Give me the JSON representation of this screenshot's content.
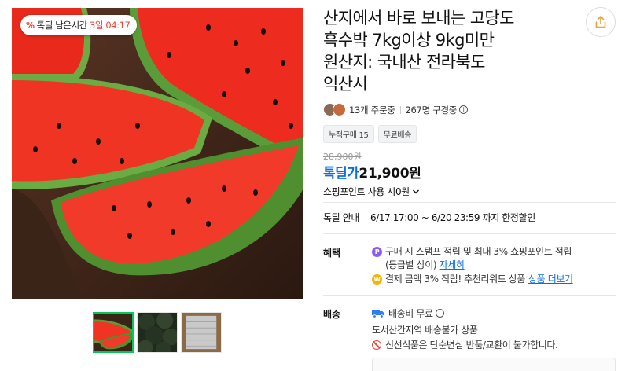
{
  "gallery": {
    "timer_badge": {
      "icon_text": "%",
      "label": "톡딜 남은시간",
      "remaining": "3일 04:17"
    },
    "thumbnails": [
      {
        "name": "watermelon-slices",
        "active": true
      },
      {
        "name": "whole-watermelons",
        "active": false
      },
      {
        "name": "packaging-box",
        "active": false
      }
    ]
  },
  "product": {
    "title_lines": [
      "산지에서 바로 보내는 고당도",
      "흑수박 7kg이상 9kg미만",
      "원산지: 국내산 전라북도",
      "익산시"
    ],
    "orders": "13개 주문중",
    "subscribers": "267명 구경중",
    "tags": [
      "누적구매 15",
      "무료배송"
    ],
    "original_price": "28,900원",
    "deal_label": "톡딜가",
    "deal_price": "21,900원",
    "points_label": "쇼핑포인트 사용 시0원"
  },
  "deal_info": {
    "label": "톡딜 안내",
    "period": "6/17 17:00 ~ 6/20 23:59 까지 한정할인"
  },
  "benefits": {
    "label": "혜택",
    "line1": "구매 시 스탬프 적립 및 최대 3% 쇼핑포인트 적립",
    "line1b": "(등급별 상이)",
    "line1_link": "자세히",
    "line2": "결제 금액 3% 적립! 추천리워드 상품",
    "line2_link": "상품 더보기"
  },
  "shipping": {
    "label": "배송",
    "fee": "배송비 무료",
    "restriction": "도서산간지역 배송불가 상품",
    "notice": "신선식품은 단순변심 반품/교환이 불가합니다."
  },
  "colors": {
    "accent_blue": "#0d6ee4",
    "alert_red": "#f04438",
    "active_green": "#03c75a"
  }
}
